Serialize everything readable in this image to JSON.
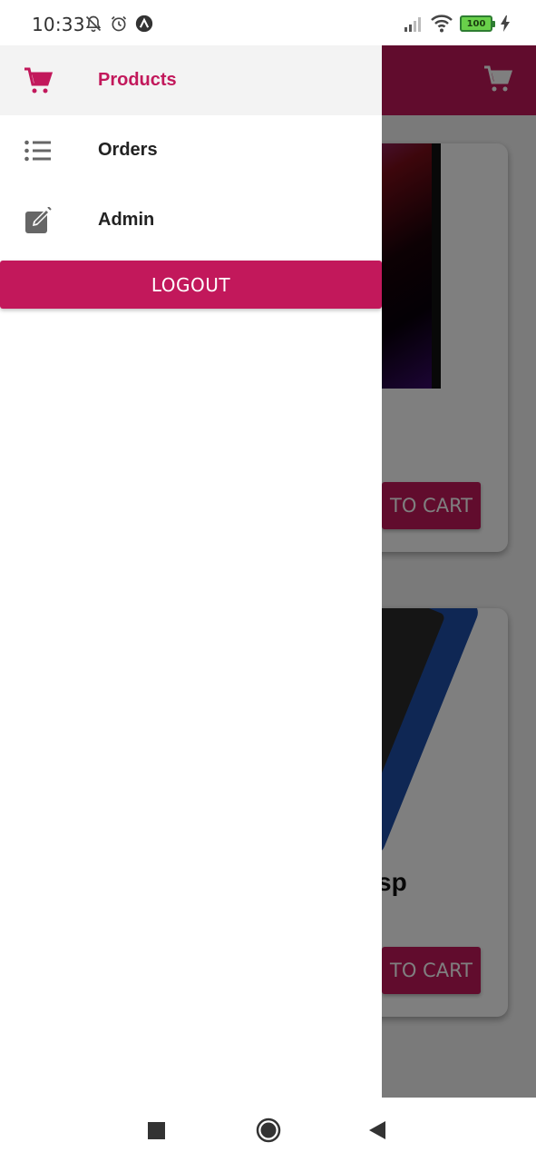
{
  "status_bar": {
    "time": "10:33",
    "icons_left": [
      "notifications-off-icon",
      "alarm-icon",
      "app-notification-icon"
    ],
    "icons_right": [
      "signal-icon",
      "wifi-icon",
      "battery-icon",
      "charging-icon"
    ],
    "battery_level": "100"
  },
  "drawer": {
    "items": [
      {
        "label": "Products",
        "icon": "cart-icon",
        "active": true
      },
      {
        "label": "Orders",
        "icon": "list-icon",
        "active": false
      },
      {
        "label": "Admin",
        "icon": "edit-icon",
        "active": false
      }
    ],
    "logout_label": "LOGOUT"
  },
  "background_app": {
    "cards": [
      {
        "title": "",
        "button_label": "TO CART"
      },
      {
        "title": "sp",
        "button_label": "TO CART"
      }
    ]
  },
  "nav_bar": {
    "buttons": [
      "recents-icon",
      "home-icon",
      "back-icon"
    ]
  },
  "colors": {
    "accent": "#c2185b",
    "drawer_active_bg": "#f3f3f3",
    "scrim": "rgba(0,0,0,0.5)"
  }
}
